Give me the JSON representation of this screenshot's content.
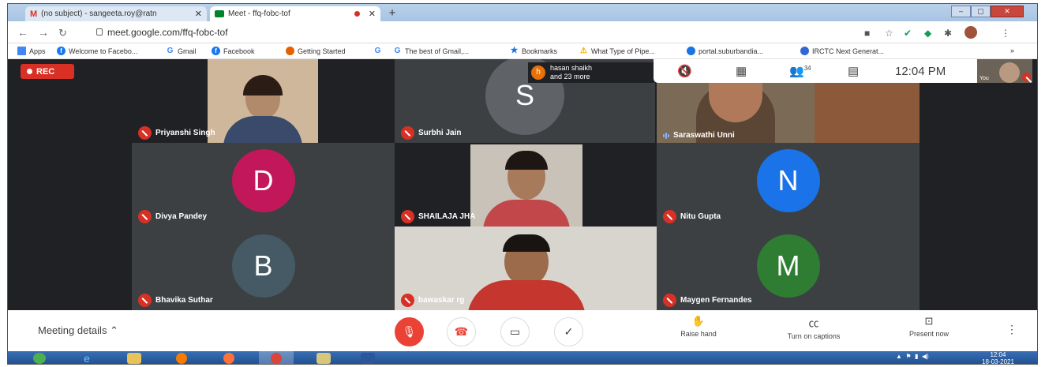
{
  "browser": {
    "tabs": [
      {
        "label": "(no subject) - sangeeta.roy@ratn",
        "icon": "gmail-icon",
        "color": "#d93025"
      },
      {
        "label": "Meet - ffq-fobc-tof",
        "icon": "meet-icon",
        "color": "#00832d"
      }
    ],
    "tab_close": "✕",
    "new_tab": "+",
    "url": "meet.google.com/ffq-fobc-tof",
    "bookmarks": [
      {
        "label": "Apps",
        "icon": "apps-grid-icon",
        "color": "#4285f4"
      },
      {
        "label": "Welcome to Facebo...",
        "icon": "facebook-icon",
        "color": "#1877f2"
      },
      {
        "label": "Gmail",
        "icon": "google-icon",
        "color": "#4285f4"
      },
      {
        "label": "Facebook",
        "icon": "facebook-icon",
        "color": "#1877f2"
      },
      {
        "label": "Getting Started",
        "icon": "firefox-icon",
        "color": "#e66000"
      },
      {
        "label": "G",
        "icon": "google-icon",
        "color": "#4285f4"
      },
      {
        "label": "The best of Gmail,...",
        "icon": "google-icon",
        "color": "#4285f4"
      },
      {
        "label": "Bookmarks",
        "icon": "star-icon",
        "color": "#1a73e8"
      },
      {
        "label": "What Type of Pipe...",
        "icon": "warning-icon",
        "color": "#f9ab00"
      },
      {
        "label": "portal.suburbandia...",
        "icon": "globe-icon",
        "color": "#1a73e8"
      },
      {
        "label": "IRCTC Next Generat...",
        "icon": "irctc-icon",
        "color": "#3367d6"
      }
    ],
    "bookmarks_overflow": "»"
  },
  "meet": {
    "rec_label": "REC",
    "join_notice": {
      "initial": "h",
      "line1": "hasan shaikh",
      "line2": "and 23 more"
    },
    "participant_count": "34",
    "clock": "12:04 PM",
    "self_label": "You",
    "participants": [
      {
        "name": "Priyanshi Singh",
        "type": "video",
        "bg": "#cfb79c"
      },
      {
        "name": "Surbhi Jain",
        "type": "avatar",
        "initial": "S",
        "color": "#5f6368"
      },
      {
        "name": "Saraswathi Unni",
        "type": "video",
        "bg": "#7b6a55",
        "speaking": true
      },
      {
        "name": "Divya Pandey",
        "type": "avatar",
        "initial": "D",
        "color": "#c2185b"
      },
      {
        "name": "SHAILAJA JHA",
        "type": "video",
        "bg": "#c9c2b8"
      },
      {
        "name": "Nitu Gupta",
        "type": "avatar",
        "initial": "N",
        "color": "#1a73e8"
      },
      {
        "name": "Bhavika Suthar",
        "type": "avatar",
        "initial": "B",
        "color": "#455a64"
      },
      {
        "name": "bawaskar rg",
        "type": "video",
        "bg": "#d8d5cf"
      },
      {
        "name": "Maygen Fernandes",
        "type": "avatar",
        "initial": "M",
        "color": "#2e7d32"
      }
    ]
  },
  "controls": {
    "meeting_details": "Meeting details",
    "raise_hand": "Raise hand",
    "captions": "Turn on captions",
    "present": "Present now"
  },
  "taskbar": {
    "time": "12:04",
    "date": "18-03-2021"
  }
}
